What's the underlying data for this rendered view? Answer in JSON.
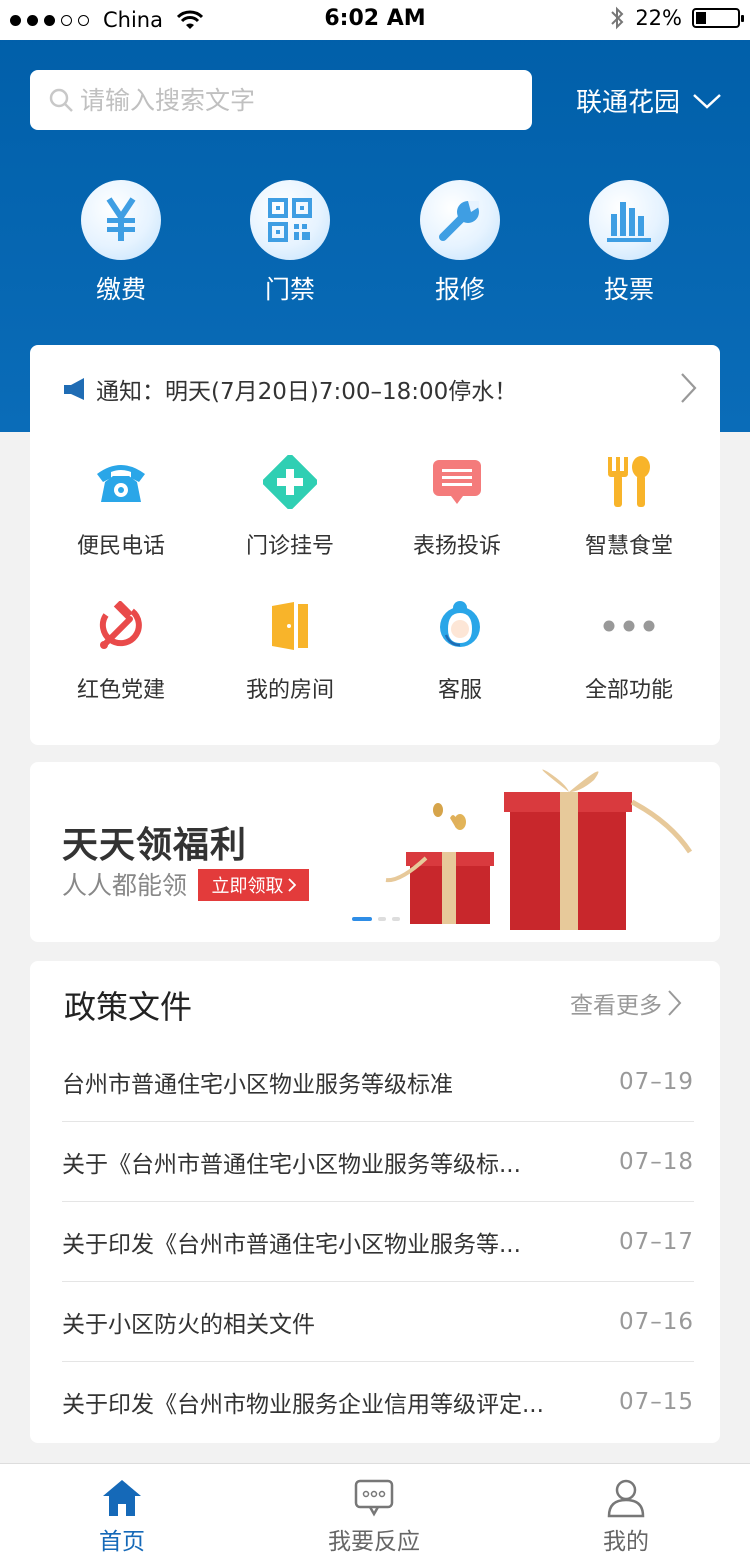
{
  "status": {
    "carrier": "China",
    "time": "6:02 AM",
    "battery": "22%"
  },
  "search": {
    "placeholder": "请输入搜索文字"
  },
  "community": "联通花园",
  "quick": [
    {
      "label": "缴费",
      "icon": "yuan-icon"
    },
    {
      "label": "门禁",
      "icon": "qr-code-icon"
    },
    {
      "label": "报修",
      "icon": "wrench-icon"
    },
    {
      "label": "投票",
      "icon": "bar-chart-icon"
    }
  ],
  "notice": {
    "text": "通知：明天(7月20日)7:00–18:00停水！"
  },
  "services": [
    {
      "label": "便民电话",
      "icon": "telephone-icon",
      "color": "#2aa6e8"
    },
    {
      "label": "门诊挂号",
      "icon": "medical-cross-icon",
      "color": "#2fcfb3"
    },
    {
      "label": "表扬投诉",
      "icon": "message-icon",
      "color": "#f47b7b"
    },
    {
      "label": "智慧食堂",
      "icon": "fork-spoon-icon",
      "color": "#f8b42a"
    },
    {
      "label": "红色党建",
      "icon": "hammer-sickle-icon",
      "color": "#e94a4a"
    },
    {
      "label": "我的房间",
      "icon": "door-icon",
      "color": "#f8b42a"
    },
    {
      "label": "客服",
      "icon": "customer-service-icon",
      "color": "#2aa6e8"
    },
    {
      "label": "全部功能",
      "icon": "more-dots-icon",
      "color": "#999999"
    }
  ],
  "banner": {
    "title": "天天领福利",
    "subtitle": "人人都能领",
    "button": "立即领取"
  },
  "policy": {
    "title": "政策文件",
    "more": "查看更多",
    "items": [
      {
        "title": "台州市普通住宅小区物业服务等级标准",
        "date": "07–19"
      },
      {
        "title": "关于《台州市普通住宅小区物业服务等级标...",
        "date": "07–18"
      },
      {
        "title": "关于印发《台州市普通住宅小区物业服务等...",
        "date": "07–17"
      },
      {
        "title": "关于小区防火的相关文件",
        "date": "07–16"
      },
      {
        "title": "关于印发《台州市物业服务企业信用等级评定...",
        "date": "07–15"
      }
    ]
  },
  "tabs": [
    {
      "label": "首页",
      "active": true
    },
    {
      "label": "我要反应",
      "active": false
    },
    {
      "label": "我的",
      "active": false
    }
  ]
}
